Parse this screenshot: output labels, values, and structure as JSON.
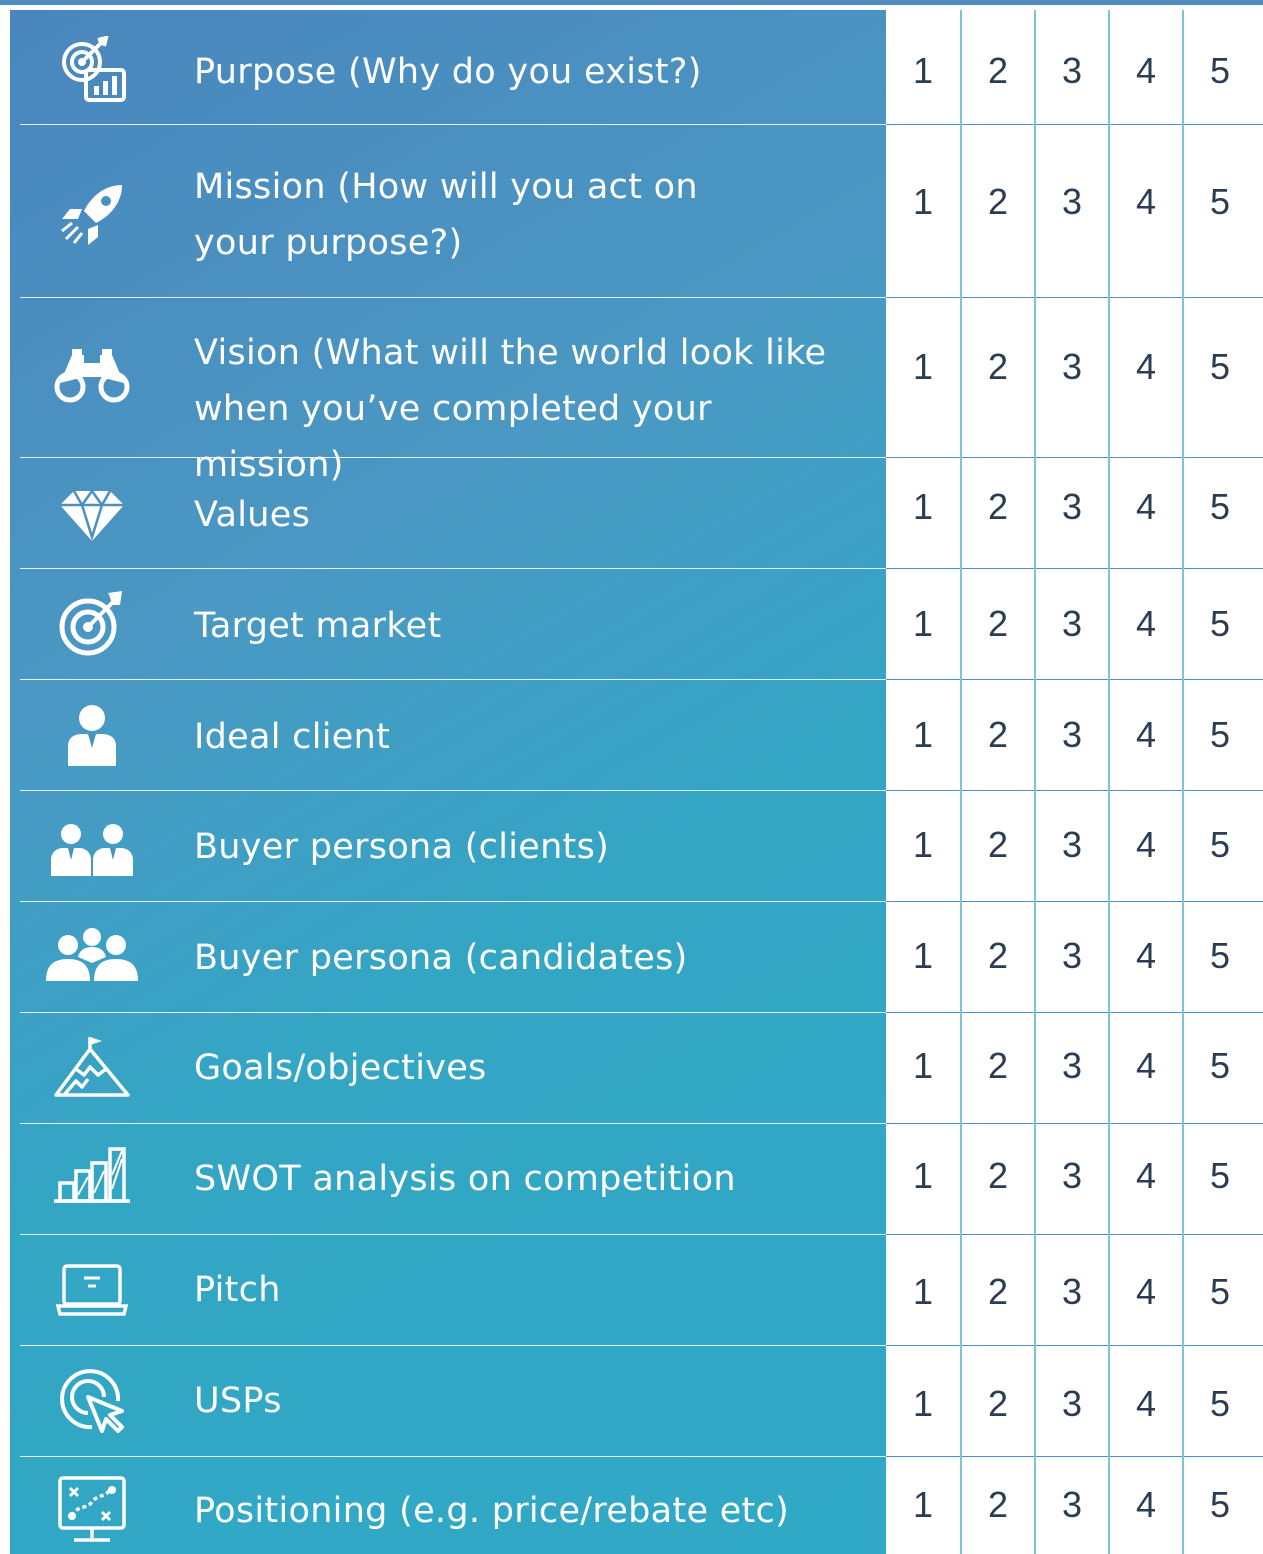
{
  "scale": [
    "1",
    "2",
    "3",
    "4",
    "5"
  ],
  "colors": {
    "panel_start": "#4a86bd",
    "panel_end": "#2fa9c6",
    "grid_line": "#7ec3d6",
    "number_text": "#2b3d52",
    "top_border": "#4f8cc2"
  },
  "rows": [
    {
      "label": "Purpose (Why do you exist?)",
      "icon": "target-chart-icon"
    },
    {
      "label": "Mission (How will you act on\nyour purpose?)",
      "icon": "rocket-icon"
    },
    {
      "label": "Vision (What will the world look like\nwhen you’ve completed your mission)",
      "icon": "binoculars-icon"
    },
    {
      "label": "Values",
      "icon": "diamond-icon"
    },
    {
      "label": "Target market",
      "icon": "target-icon"
    },
    {
      "label": "Ideal client",
      "icon": "person-icon"
    },
    {
      "label": "Buyer persona (clients)",
      "icon": "two-people-icon"
    },
    {
      "label": "Buyer persona (candidates)",
      "icon": "group-people-icon"
    },
    {
      "label": "Goals/objectives",
      "icon": "mountain-flag-icon"
    },
    {
      "label": "SWOT analysis on competition",
      "icon": "bar-chart-icon"
    },
    {
      "label": "Pitch",
      "icon": "laptop-icon"
    },
    {
      "label": "USPs",
      "icon": "cursor-click-icon"
    },
    {
      "label": "Positioning (e.g. price/rebate etc)",
      "icon": "strategy-board-icon"
    }
  ]
}
